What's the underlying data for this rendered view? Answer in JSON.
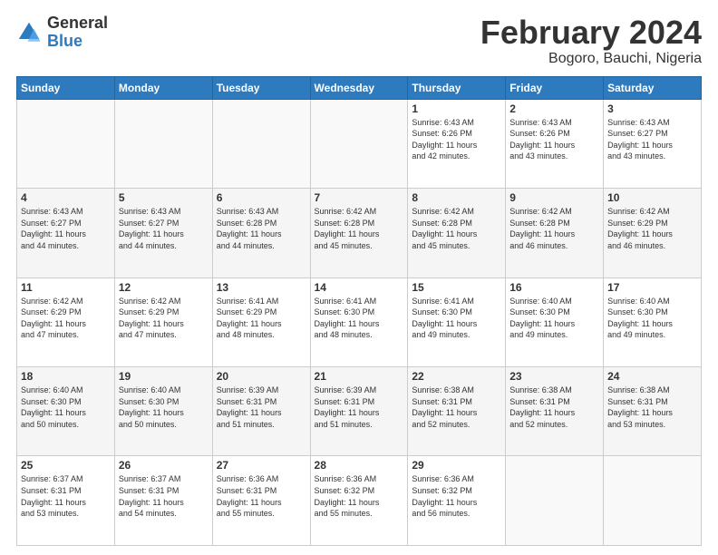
{
  "header": {
    "logo_general": "General",
    "logo_blue": "Blue",
    "title": "February 2024",
    "location": "Bogoro, Bauchi, Nigeria"
  },
  "weekdays": [
    "Sunday",
    "Monday",
    "Tuesday",
    "Wednesday",
    "Thursday",
    "Friday",
    "Saturday"
  ],
  "weeks": [
    [
      {
        "day": "",
        "info": ""
      },
      {
        "day": "",
        "info": ""
      },
      {
        "day": "",
        "info": ""
      },
      {
        "day": "",
        "info": ""
      },
      {
        "day": "1",
        "info": "Sunrise: 6:43 AM\nSunset: 6:26 PM\nDaylight: 11 hours\nand 42 minutes."
      },
      {
        "day": "2",
        "info": "Sunrise: 6:43 AM\nSunset: 6:26 PM\nDaylight: 11 hours\nand 43 minutes."
      },
      {
        "day": "3",
        "info": "Sunrise: 6:43 AM\nSunset: 6:27 PM\nDaylight: 11 hours\nand 43 minutes."
      }
    ],
    [
      {
        "day": "4",
        "info": "Sunrise: 6:43 AM\nSunset: 6:27 PM\nDaylight: 11 hours\nand 44 minutes."
      },
      {
        "day": "5",
        "info": "Sunrise: 6:43 AM\nSunset: 6:27 PM\nDaylight: 11 hours\nand 44 minutes."
      },
      {
        "day": "6",
        "info": "Sunrise: 6:43 AM\nSunset: 6:28 PM\nDaylight: 11 hours\nand 44 minutes."
      },
      {
        "day": "7",
        "info": "Sunrise: 6:42 AM\nSunset: 6:28 PM\nDaylight: 11 hours\nand 45 minutes."
      },
      {
        "day": "8",
        "info": "Sunrise: 6:42 AM\nSunset: 6:28 PM\nDaylight: 11 hours\nand 45 minutes."
      },
      {
        "day": "9",
        "info": "Sunrise: 6:42 AM\nSunset: 6:28 PM\nDaylight: 11 hours\nand 46 minutes."
      },
      {
        "day": "10",
        "info": "Sunrise: 6:42 AM\nSunset: 6:29 PM\nDaylight: 11 hours\nand 46 minutes."
      }
    ],
    [
      {
        "day": "11",
        "info": "Sunrise: 6:42 AM\nSunset: 6:29 PM\nDaylight: 11 hours\nand 47 minutes."
      },
      {
        "day": "12",
        "info": "Sunrise: 6:42 AM\nSunset: 6:29 PM\nDaylight: 11 hours\nand 47 minutes."
      },
      {
        "day": "13",
        "info": "Sunrise: 6:41 AM\nSunset: 6:29 PM\nDaylight: 11 hours\nand 48 minutes."
      },
      {
        "day": "14",
        "info": "Sunrise: 6:41 AM\nSunset: 6:30 PM\nDaylight: 11 hours\nand 48 minutes."
      },
      {
        "day": "15",
        "info": "Sunrise: 6:41 AM\nSunset: 6:30 PM\nDaylight: 11 hours\nand 49 minutes."
      },
      {
        "day": "16",
        "info": "Sunrise: 6:40 AM\nSunset: 6:30 PM\nDaylight: 11 hours\nand 49 minutes."
      },
      {
        "day": "17",
        "info": "Sunrise: 6:40 AM\nSunset: 6:30 PM\nDaylight: 11 hours\nand 49 minutes."
      }
    ],
    [
      {
        "day": "18",
        "info": "Sunrise: 6:40 AM\nSunset: 6:30 PM\nDaylight: 11 hours\nand 50 minutes."
      },
      {
        "day": "19",
        "info": "Sunrise: 6:40 AM\nSunset: 6:30 PM\nDaylight: 11 hours\nand 50 minutes."
      },
      {
        "day": "20",
        "info": "Sunrise: 6:39 AM\nSunset: 6:31 PM\nDaylight: 11 hours\nand 51 minutes."
      },
      {
        "day": "21",
        "info": "Sunrise: 6:39 AM\nSunset: 6:31 PM\nDaylight: 11 hours\nand 51 minutes."
      },
      {
        "day": "22",
        "info": "Sunrise: 6:38 AM\nSunset: 6:31 PM\nDaylight: 11 hours\nand 52 minutes."
      },
      {
        "day": "23",
        "info": "Sunrise: 6:38 AM\nSunset: 6:31 PM\nDaylight: 11 hours\nand 52 minutes."
      },
      {
        "day": "24",
        "info": "Sunrise: 6:38 AM\nSunset: 6:31 PM\nDaylight: 11 hours\nand 53 minutes."
      }
    ],
    [
      {
        "day": "25",
        "info": "Sunrise: 6:37 AM\nSunset: 6:31 PM\nDaylight: 11 hours\nand 53 minutes."
      },
      {
        "day": "26",
        "info": "Sunrise: 6:37 AM\nSunset: 6:31 PM\nDaylight: 11 hours\nand 54 minutes."
      },
      {
        "day": "27",
        "info": "Sunrise: 6:36 AM\nSunset: 6:31 PM\nDaylight: 11 hours\nand 55 minutes."
      },
      {
        "day": "28",
        "info": "Sunrise: 6:36 AM\nSunset: 6:32 PM\nDaylight: 11 hours\nand 55 minutes."
      },
      {
        "day": "29",
        "info": "Sunrise: 6:36 AM\nSunset: 6:32 PM\nDaylight: 11 hours\nand 56 minutes."
      },
      {
        "day": "",
        "info": ""
      },
      {
        "day": "",
        "info": ""
      }
    ]
  ]
}
